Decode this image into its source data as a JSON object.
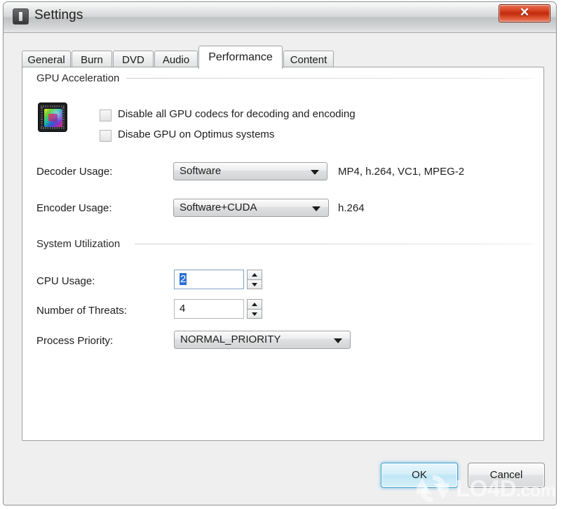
{
  "window": {
    "title": "Settings",
    "icon": "app-icon",
    "close_label": "✕"
  },
  "tabs": [
    {
      "label": "General",
      "active": false
    },
    {
      "label": "Burn",
      "active": false
    },
    {
      "label": "DVD",
      "active": false
    },
    {
      "label": "Audio",
      "active": false
    },
    {
      "label": "Performance",
      "active": true
    },
    {
      "label": "Content",
      "active": false
    }
  ],
  "groups": {
    "gpu": {
      "title": "GPU Acceleration",
      "checkboxes": [
        {
          "label": "Disable all GPU codecs for decoding and encoding",
          "checked": false
        },
        {
          "label": "Disabe GPU on Optimus systems",
          "checked": false
        }
      ],
      "fields": [
        {
          "label": "Decoder Usage:",
          "value": "Software",
          "note": "MP4, h.264, VC1, MPEG-2"
        },
        {
          "label": "Encoder Usage:",
          "value": "Software+CUDA",
          "note": "h.264"
        }
      ]
    },
    "system": {
      "title": "System Utilization",
      "cpu_usage": {
        "label": "CPU Usage:",
        "value": "2",
        "selected": true
      },
      "threads": {
        "label": "Number of Threats:",
        "value": "4",
        "selected": false
      },
      "priority": {
        "label": "Process Priority:",
        "value": "NORMAL_PRIORITY"
      }
    }
  },
  "buttons": {
    "ok": "OK",
    "cancel": "Cancel"
  },
  "watermark": {
    "text": "LO4D",
    "suffix": ".com"
  },
  "colors": {
    "accent_default_button": "#3f9fd0",
    "close_button": "#bf2b0d",
    "selection": "#2a6ed4"
  }
}
